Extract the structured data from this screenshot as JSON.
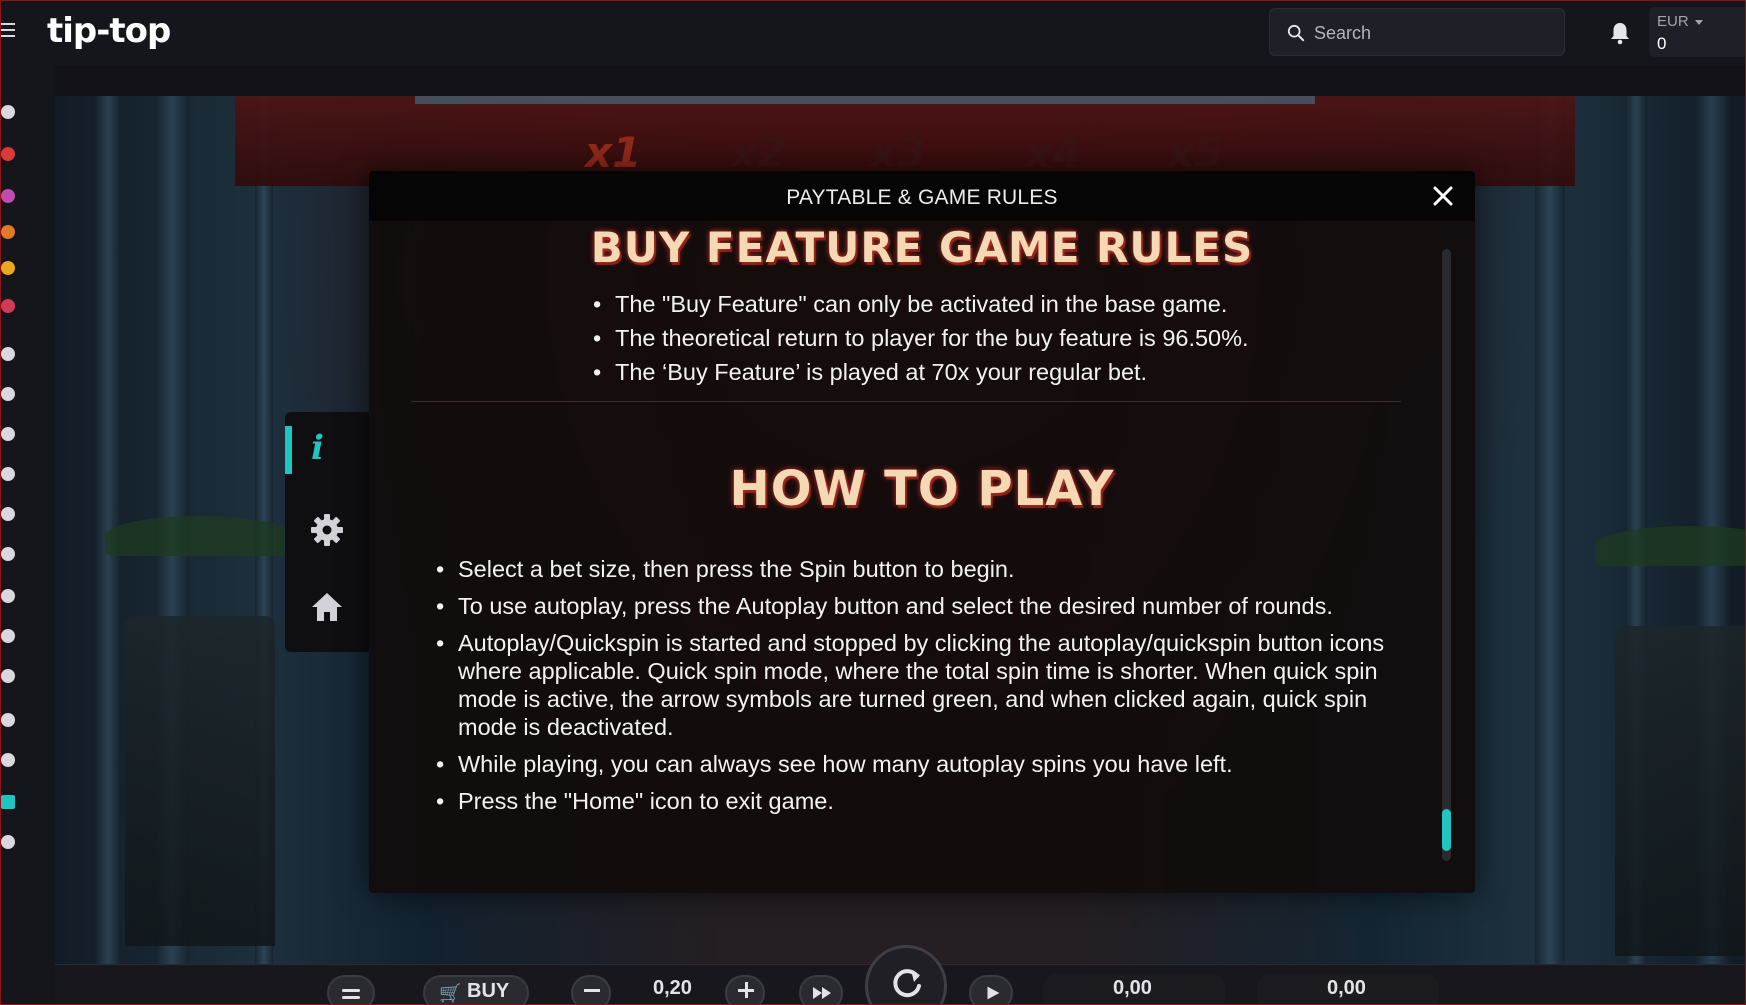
{
  "topbar": {
    "logo_text": "tip-top",
    "search_placeholder": "Search",
    "wallet_currency": "EUR",
    "wallet_balance": "0"
  },
  "game_background": {
    "multipliers": [
      "x1",
      "x2",
      "x3",
      "x4",
      "x5"
    ]
  },
  "modal": {
    "title": "PAYTABLE & GAME RULES",
    "sections": [
      {
        "title": "BUY FEATURE GAME RULES",
        "rules": [
          "The \"Buy Feature\" can only be activated in the base game.",
          "The theoretical return to player for the buy feature is 96.50%.",
          "The ‘Buy Feature’ is played at 70x your regular bet."
        ]
      },
      {
        "title": "HOW TO PLAY",
        "rules": [
          "Select a bet size, then press the Spin button to begin.",
          "To use autoplay, press the Autoplay button and select the desired number of rounds.",
          "Autoplay/Quickspin is started and stopped by clicking the autoplay/quickspin button icons where applicable. Quick spin mode, where the total spin time is shorter. When quick spin mode is active, the arrow symbols are turned green, and when clicked again, quick spin mode is deactivated.",
          "While playing, you can always see how many autoplay spins you have left.",
          "Press the \"Home\" icon to exit game."
        ]
      }
    ]
  },
  "side_menu": {
    "info_glyph": "i",
    "items": [
      "info-icon",
      "gear-icon",
      "home-icon"
    ],
    "accent": "#1fc5c0"
  },
  "controls": {
    "buy_label": "BUY",
    "bet_value": "0,20",
    "balance_value": "0,00",
    "win_value": "0,00"
  },
  "colors": {
    "accent": "#1fc5c0",
    "title_glow": "#c8362a",
    "brand_border": "#8a1418"
  }
}
